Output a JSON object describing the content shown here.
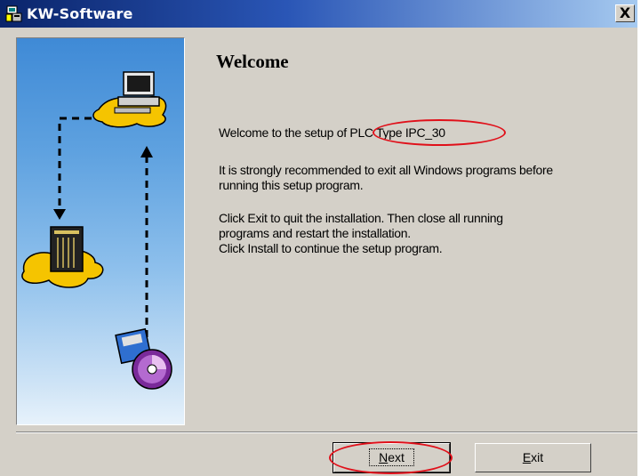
{
  "window": {
    "title": "KW-Software",
    "close_symbol": "X"
  },
  "content": {
    "heading": "Welcome",
    "welcome_prefix": "Welcome to the setup of ",
    "product_name": "PLC Type IPC_30",
    "paragraph_1_line_1": "It is strongly recommended to exit all Windows programs before",
    "paragraph_1_line_2": "running this setup program.",
    "paragraph_2_line_1": "Click Exit to quit the installation. Then  close all running",
    "paragraph_2_line_2": "programs and restart the installation.",
    "paragraph_2_line_3": "Click Install to continue the setup program."
  },
  "buttons": {
    "next_mnemonic": "N",
    "next_rest": "ext",
    "exit_mnemonic": "E",
    "exit_rest": "xit"
  },
  "colors": {
    "title_gradient_start": "#0a246a",
    "title_gradient_end": "#a6caf0",
    "dialog_face": "#d4d0c8",
    "highlight_ellipse": "#e0101a",
    "yellow_platform": "#f5c400"
  }
}
